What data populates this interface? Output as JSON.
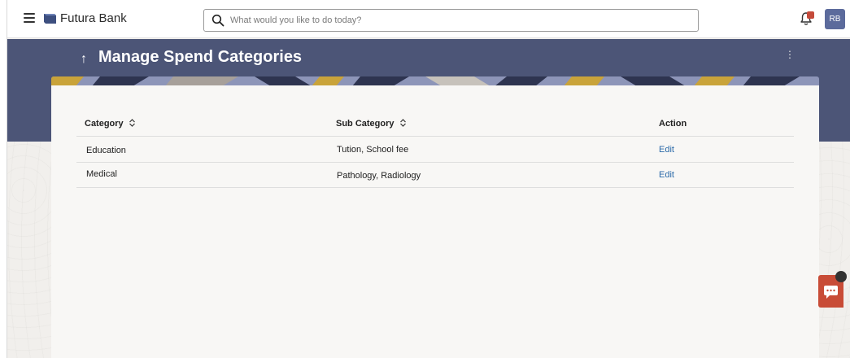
{
  "app": {
    "brand": "Futura Bank",
    "search_placeholder": "What would you like to do today?",
    "notification_badge": true,
    "user_initials": "RB"
  },
  "page": {
    "back_glyph": "↑",
    "title": "Manage Spend Categories",
    "more_glyph": "⋮"
  },
  "table": {
    "headers": {
      "category": "Category",
      "sub_category": "Sub Category",
      "action": "Action"
    },
    "rows": [
      {
        "category": "Education",
        "sub_category": "Tution, School fee",
        "action": "Edit"
      },
      {
        "category": "Medical",
        "sub_category": "Pathology, Radiology",
        "action": "Edit"
      }
    ]
  },
  "colors": {
    "banner": "#4c5577",
    "accent_link": "#2b6aa8",
    "chat_button": "#c84c37",
    "avatar": "#5c6b9c"
  },
  "icons": {
    "menu": "hamburger-menu-icon",
    "logo": "futura-bank-logo",
    "search": "search-icon",
    "bell": "bell-icon",
    "sort": "sort-icon",
    "chat": "chat-icon"
  }
}
